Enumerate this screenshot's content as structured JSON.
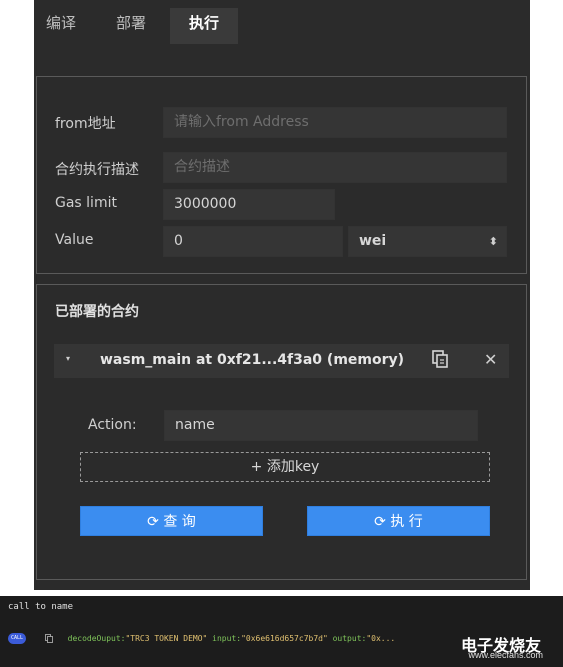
{
  "tabs": [
    {
      "label": "编译"
    },
    {
      "label": "部署"
    },
    {
      "label": "执行"
    }
  ],
  "exec_form": {
    "from_label": "from地址",
    "from_placeholder": "请输入from Address",
    "desc_label": "合约执行描述",
    "desc_placeholder": "合约描述",
    "gas_label": "Gas limit",
    "gas_value": "3000000",
    "value_label": "Value",
    "value_value": "0",
    "unit_value": "wei",
    "unit_arrow": "⬍"
  },
  "deployed": {
    "title": "已部署的合约",
    "contract_name": "wasm_main at 0xf21...4f3a0 (memory)",
    "action_label": "Action:",
    "action_value": "name",
    "add_key_label": "+ 添加key",
    "query_button": "⟳ 查 询",
    "exec_button": "⟳ 执 行"
  },
  "console": {
    "line1": "call to name",
    "badge": "CALL",
    "decode_key": "decodeOuput:",
    "decode_val": "\"TRC3 TOKEN DEMO\"",
    "input_key": "input:",
    "input_val": "\"0x6e616d657c7b7d\"",
    "output_key": "output:",
    "output_val": "\"0x..."
  },
  "watermark": {
    "line1": "电子发烧友",
    "line2": "www.elecfans.com"
  }
}
